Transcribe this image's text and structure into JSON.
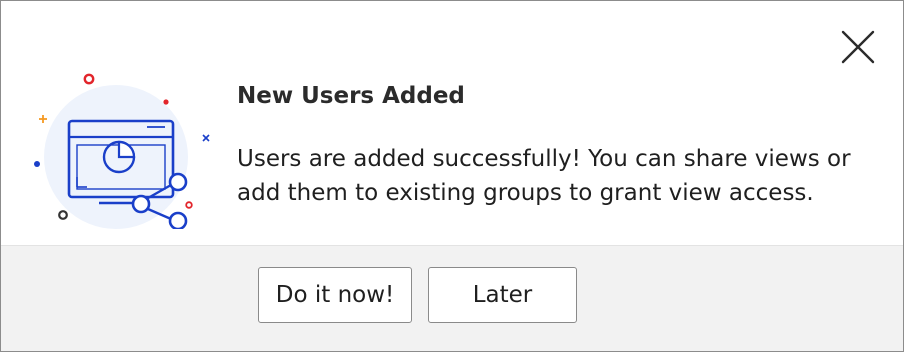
{
  "dialog": {
    "title": "New Users Added",
    "message": "Users are added successfully! You can share views or add them to existing groups to grant view access.",
    "close_icon": "close-icon",
    "illustration_icon": "share-report-illustration"
  },
  "actions": {
    "primary_label": "Do it now!",
    "secondary_label": "Later"
  },
  "colors": {
    "accent": "#1a3fc9",
    "illustration_bg": "#eef3fc",
    "decor_red": "#e2252b",
    "decor_orange": "#f59a23",
    "footer_bg": "#f2f2f2",
    "text": "#1f1f1f"
  }
}
